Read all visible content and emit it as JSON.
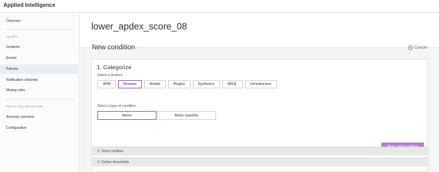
{
  "app": {
    "title": "Applied Intelligence"
  },
  "sidebar": {
    "overview": "Overview",
    "alerts_heading": "ALERTS",
    "alerts_items": [
      {
        "label": "Incidents"
      },
      {
        "label": "Events"
      },
      {
        "label": "Policies",
        "active": true
      },
      {
        "label": "Notification channels"
      },
      {
        "label": "Muting rules"
      }
    ],
    "proactive_heading": "PROACTIVE DETECTION",
    "proactive_items": [
      {
        "label": "Anomaly overview"
      },
      {
        "label": "Configuration"
      }
    ]
  },
  "main": {
    "entity_title": "lower_apdex_score_08",
    "section_title": "New condition",
    "cancel_label": "Cancel",
    "step1": {
      "title": "1. Categorize",
      "product_label": "Select a product",
      "products": [
        "APM",
        "Browser",
        "Mobile",
        "Plugins",
        "Synthetics",
        "NRQL",
        "Infrastructure"
      ],
      "selected_product": "Browser",
      "condition_label": "Select a type of condition",
      "conditions": [
        "Metric",
        "Metric baseline"
      ],
      "selected_condition": "Metric",
      "next_label": "Next, select entities"
    },
    "step2_label": "2. Select entities",
    "step3_label": "3. Define thresholds"
  },
  "colors": {
    "accent": "#9f57b8",
    "next_button": "#b27fc7",
    "active_nav": "#e8f0f5"
  }
}
